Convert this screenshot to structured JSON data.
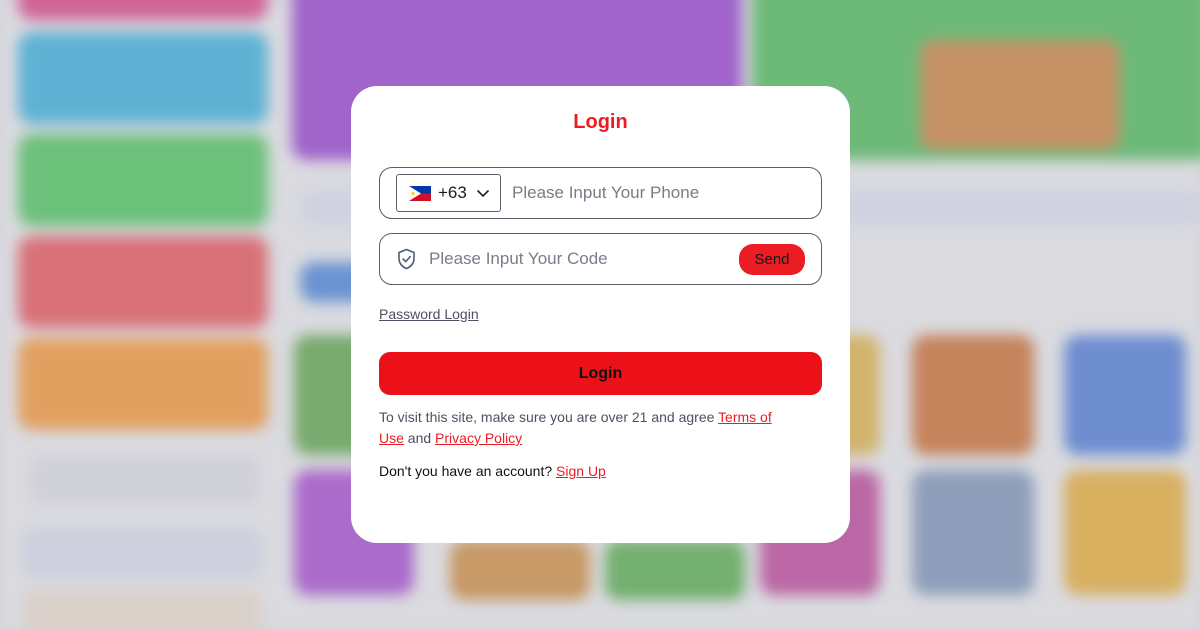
{
  "modal": {
    "title": "Login",
    "phone": {
      "country_flag": "philippines-flag",
      "dial_code": "+63",
      "placeholder": "Please Input Your Phone",
      "value": ""
    },
    "code": {
      "placeholder": "Please Input Your Code",
      "value": "",
      "send_label": "Send"
    },
    "password_login_label": "Password Login",
    "login_button_label": "Login",
    "terms": {
      "prefix": "To visit this site, make sure you are over 21 and agree ",
      "terms_link": "Terms of Use",
      "connector": " and ",
      "privacy_link": "Privacy Policy"
    },
    "signup": {
      "prompt": "Don't you have an account? ",
      "link": "Sign Up"
    }
  },
  "colors": {
    "accent": "#ec1c24",
    "field_border": "#5b5e6a",
    "muted_text": "#4d5061"
  }
}
